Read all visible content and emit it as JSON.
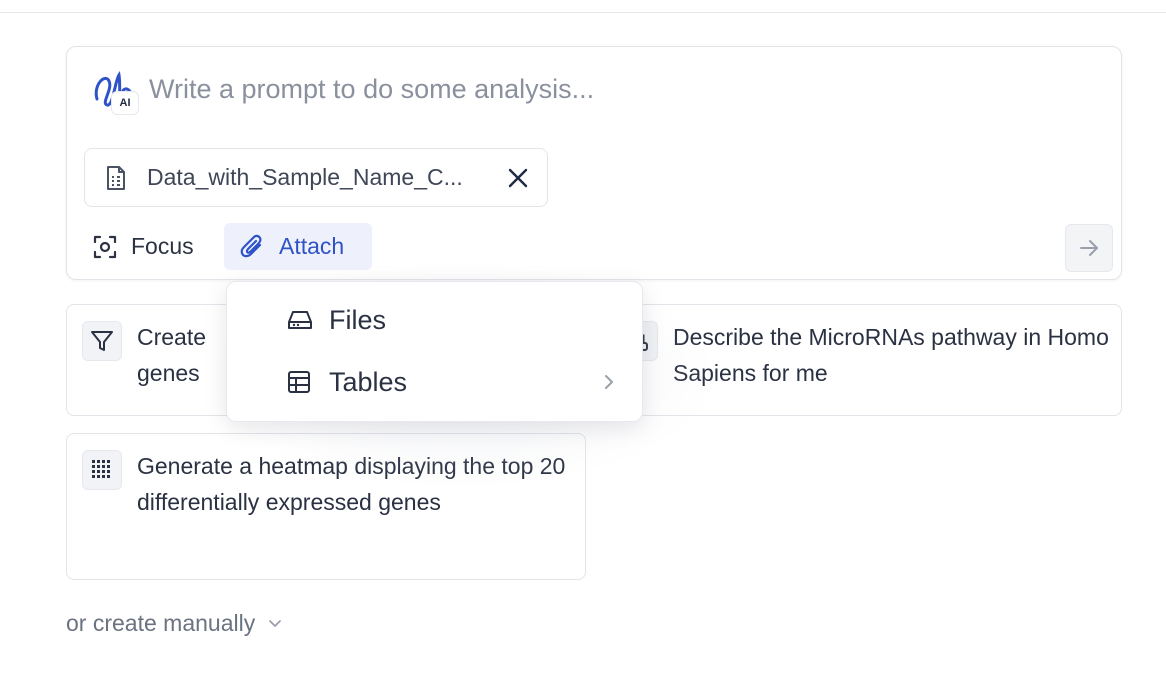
{
  "prompt": {
    "logo_badge": "AI",
    "placeholder": "Write a prompt to do some analysis...",
    "value": "",
    "attachment": {
      "file_name": "Data_with_Sample_Name_C..."
    },
    "tools": {
      "focus_label": "Focus",
      "attach_label": "Attach"
    }
  },
  "attach_menu": {
    "items": [
      {
        "label": "Files",
        "icon": "drive-icon"
      },
      {
        "label": "Tables",
        "icon": "table-icon",
        "has_submenu": true
      }
    ]
  },
  "suggestions": [
    {
      "icon": "filter-icon",
      "line1": "Create",
      "line2": "genes"
    },
    {
      "icon": "pathway-icon",
      "text": "Describe the MicroRNAs pathway in Homo Sapiens for me"
    },
    {
      "icon": "heatmap-icon",
      "text": "Generate a heatmap displaying the top 20 differentially expressed genes"
    }
  ],
  "manual": {
    "label": "or create manually"
  },
  "colors": {
    "accent": "#2f52c8",
    "attach_bg": "#eef1fb",
    "border": "#e2e4e9"
  }
}
